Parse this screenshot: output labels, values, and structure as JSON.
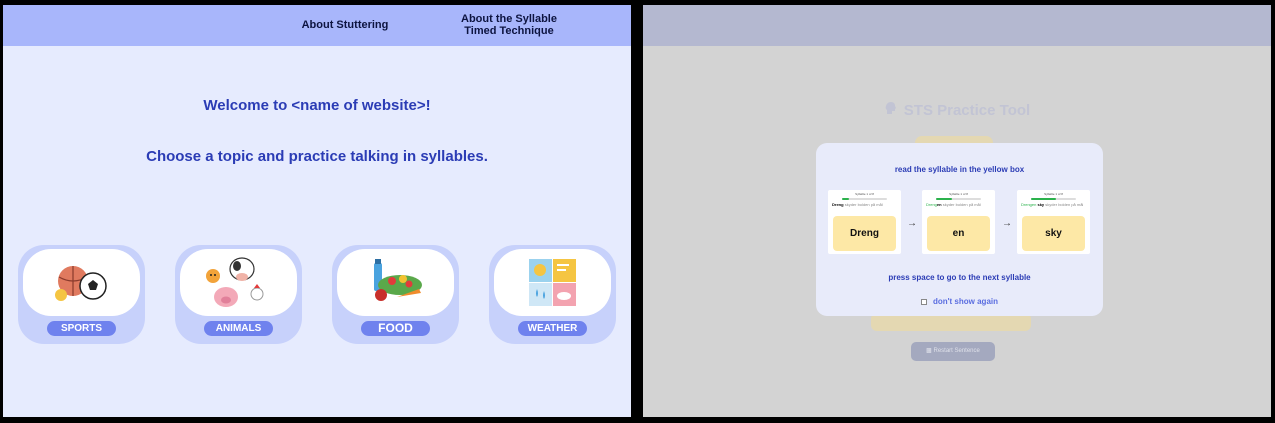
{
  "left": {
    "nav": {
      "about_stuttering": "About Stuttering",
      "about_syllable_line1": "About the Syllable",
      "about_syllable_line2": "Timed Technique"
    },
    "welcome": "Welcome to <name of website>!",
    "choose": "Choose a topic and practice talking in syllables.",
    "topics": [
      {
        "label": "SPORTS",
        "icon": "sports-balls-icon"
      },
      {
        "label": "ANIMALS",
        "icon": "farm-animals-icon"
      },
      {
        "label": "FOOD",
        "icon": "vegetables-icon"
      },
      {
        "label": "WEATHER",
        "icon": "weather-icon"
      }
    ]
  },
  "right": {
    "title": "STS Practice Tool",
    "title_icon": "speaking-head-icon",
    "restart_label": "Restart Sentence",
    "modal": {
      "title": "read the syllable in the yellow box",
      "steps": [
        {
          "word": "Dreng",
          "highlight": "Dreng",
          "progress": 0.15
        },
        {
          "word": "en",
          "highlight": "en",
          "progress": 0.35
        },
        {
          "word": "sky",
          "highlight": "sky",
          "progress": 0.55
        }
      ],
      "step_small_label": "Syllable 1 of 8",
      "sentence_rest": "skyder bolden på mål",
      "press": "press space to go to the next syllable",
      "dont_show": "don't show again"
    }
  },
  "colors": {
    "accent": "#2b3cb5",
    "nav_bg": "#a8b6fb",
    "page_bg": "#e6ebfe",
    "pill": "#6f82ee",
    "yellow": "#fde8a6"
  }
}
